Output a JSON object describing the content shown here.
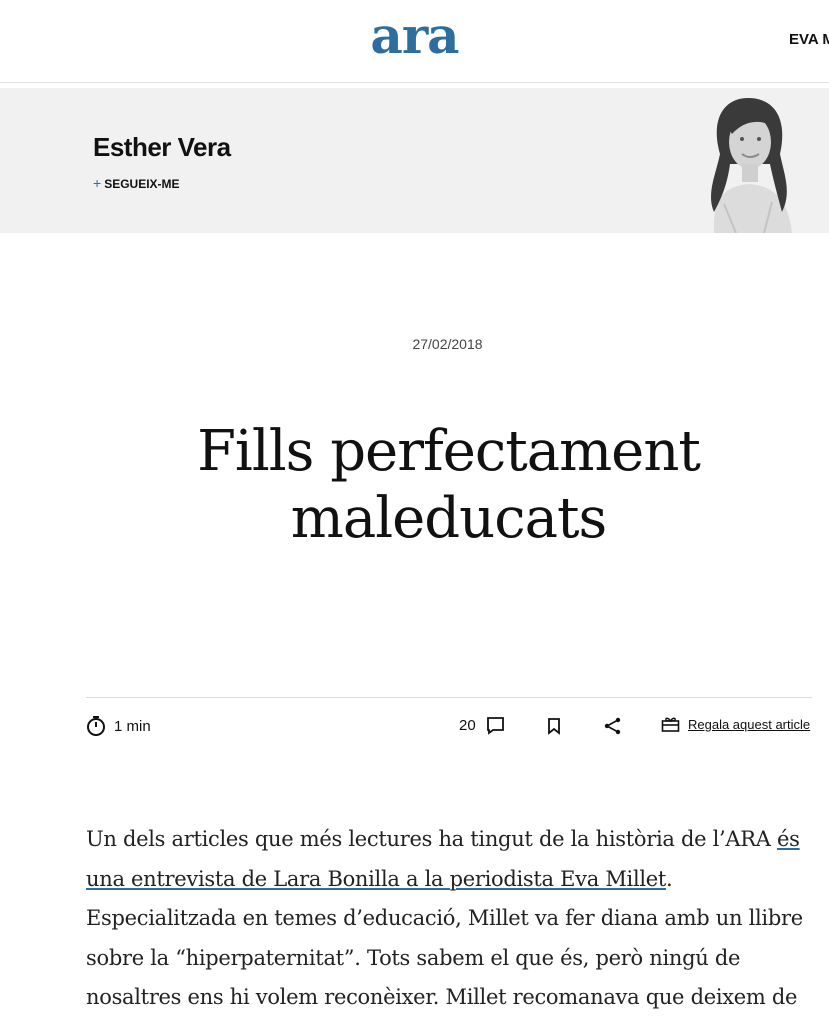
{
  "header": {
    "logo": "ara",
    "nav_author": "EVA M"
  },
  "author": {
    "name": "Esther Vera",
    "follow_label": "SEGUEIX-ME",
    "avatar_icon": "author-portrait"
  },
  "article": {
    "date": "27/02/2018",
    "title": "Fills perfectament maleducats"
  },
  "toolbar": {
    "reading_time": "1 min",
    "comment_count": "20",
    "gift_label": "Regala aquest article"
  },
  "body": {
    "p1_before": "Un dels articles que més lectures ha tingut de la història de l’ARA ",
    "p1_link": "és una entrevista de Lara Bonilla a la periodista Eva Millet",
    "p1_after": ". Especialitzada en temes d’educació, Millet va fer diana amb un llibre sobre la “hiperpaternitat”. Tots sabem el que és, però ningú de nosaltres ens hi volem reconèixer. Millet recomanava que deixem de"
  },
  "colors": {
    "brand": "#2e6e9e",
    "author_band": "#f1f1f1"
  }
}
